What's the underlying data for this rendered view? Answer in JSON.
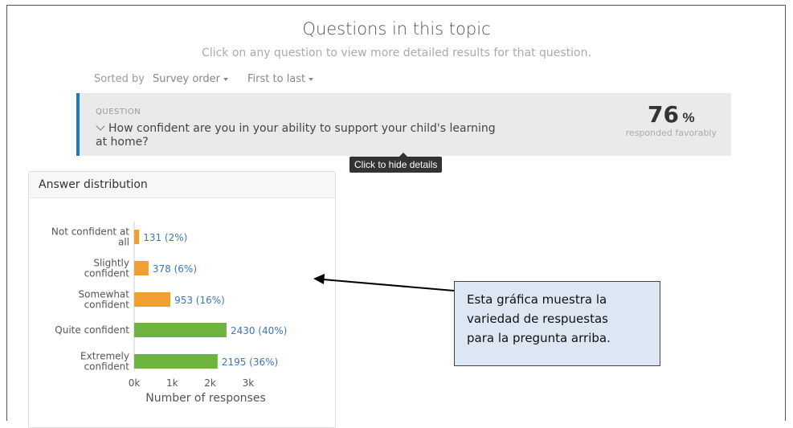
{
  "header": {
    "title": "Questions in this topic",
    "subtitle": "Click on any question to view more detailed results for that question."
  },
  "sort": {
    "label": "Sorted by",
    "order_value": "Survey order",
    "direction_value": "First to last"
  },
  "question": {
    "label": "QUESTION",
    "text": "How confident are you in your ability to support your child's learning at home?",
    "percent": "76",
    "percent_symbol": "%",
    "percent_caption": "responded favorably",
    "tooltip": "Click to hide details"
  },
  "panel": {
    "title": "Answer distribution"
  },
  "chart_data": {
    "type": "bar",
    "orientation": "horizontal",
    "categories": [
      [
        "Not confident at",
        "all"
      ],
      [
        "Slightly",
        "confident"
      ],
      [
        "Somewhat",
        "confident"
      ],
      [
        "Quite confident"
      ],
      [
        "Extremely",
        "confident"
      ]
    ],
    "values": [
      131,
      378,
      953,
      2430,
      2195
    ],
    "labels": [
      "131 (2%)",
      "378 (6%)",
      "953 (16%)",
      "2430 (40%)",
      "2195 (36%)"
    ],
    "colors": [
      "#f0a030",
      "#f0a030",
      "#f0a030",
      "#6db33f",
      "#6db33f"
    ],
    "xticks": [
      "0k",
      "1k",
      "2k",
      "3k"
    ],
    "xlim": [
      0,
      3000
    ],
    "xlabel": "Number of responses",
    "label_color": "#3a78b8"
  },
  "annotation": {
    "lines": [
      "Esta gráfica muestra la",
      "variedad de respuestas",
      "para la pregunta arriba."
    ]
  }
}
